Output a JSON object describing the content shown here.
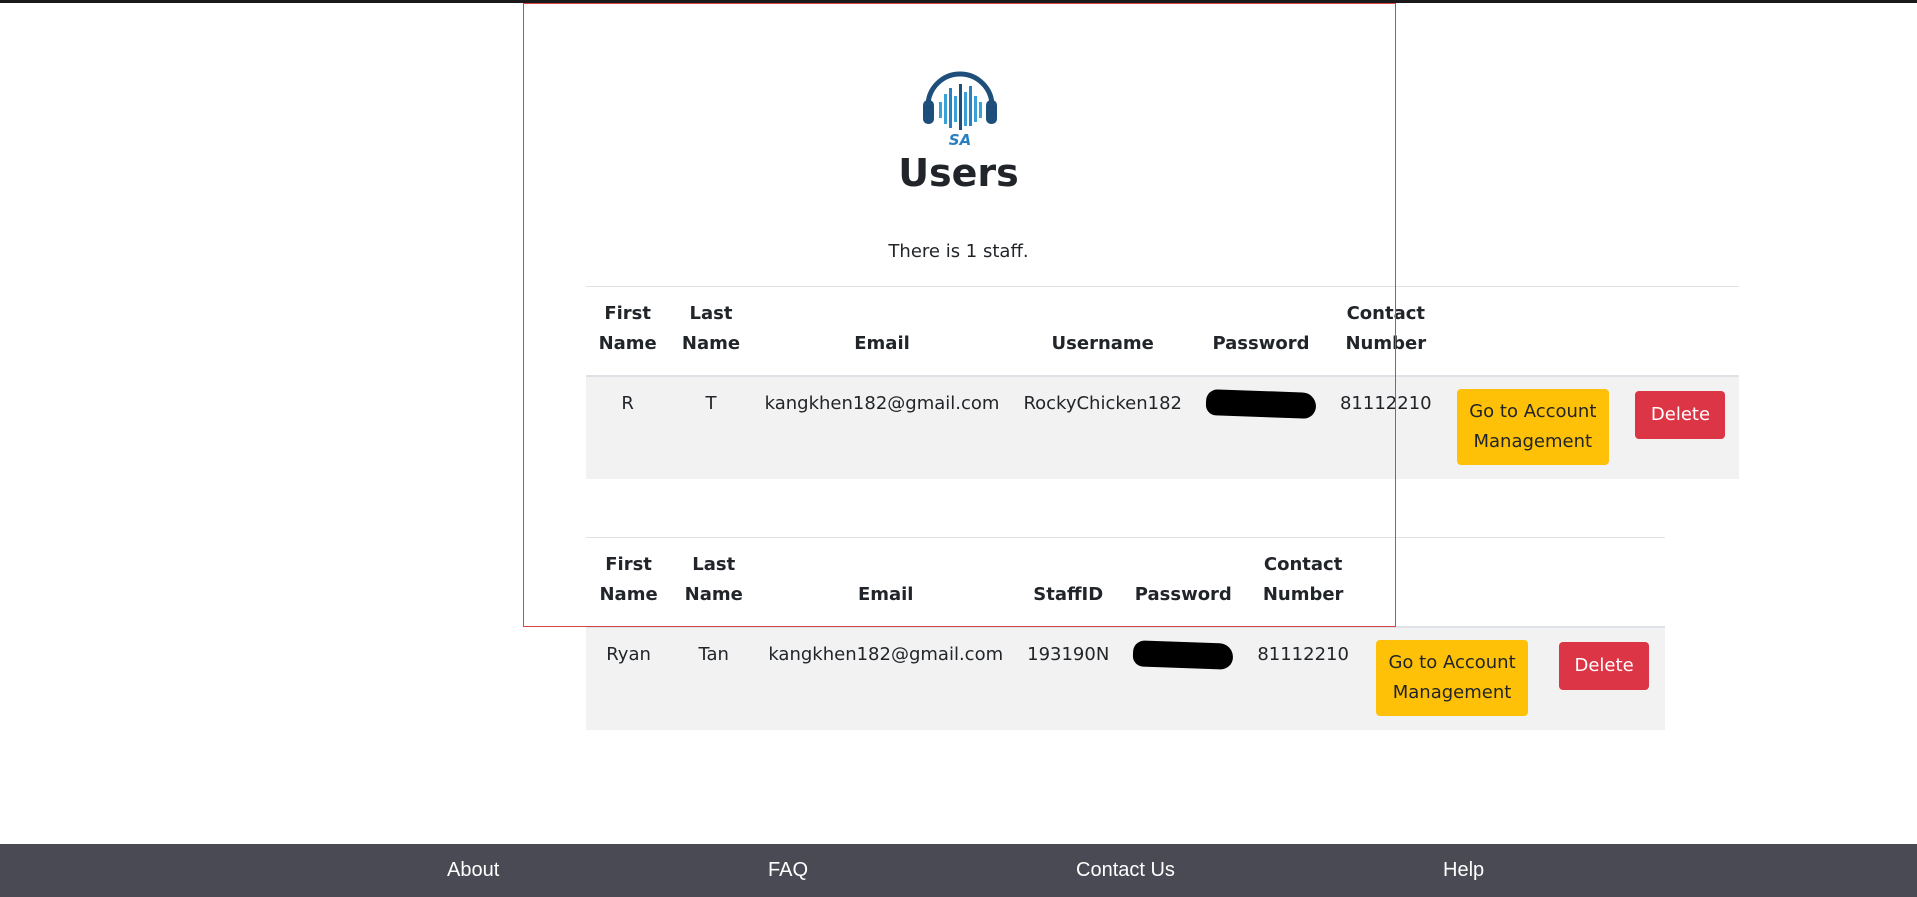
{
  "logo": {
    "text": "SA",
    "icon": "headphones-soundwave-logo"
  },
  "page": {
    "title": "Users",
    "staff_count_text": "There is 1 staff."
  },
  "users_table": {
    "headers": {
      "first_name": "First Name",
      "last_name": "Last Name",
      "email": "Email",
      "username": "Username",
      "password": "Password",
      "contact": "Contact Number"
    },
    "rows": [
      {
        "first_name": "R",
        "last_name": "T",
        "email": "kangkhen182@gmail.com",
        "username": "RockyChicken182",
        "contact": "81112210",
        "manage_label": "Go to Account Management",
        "delete_label": "Delete"
      }
    ]
  },
  "staff_table": {
    "headers": {
      "first_name": "First Name",
      "last_name": "Last Name",
      "email": "Email",
      "staff_id": "StaffID",
      "password": "Password",
      "contact": "Contact Number"
    },
    "rows": [
      {
        "first_name": "Ryan",
        "last_name": "Tan",
        "email": "kangkhen182@gmail.com",
        "staff_id": "193190N",
        "contact": "81112210",
        "manage_label": "Go to Account Management",
        "delete_label": "Delete"
      }
    ]
  },
  "footer": {
    "about": "About",
    "faq": "FAQ",
    "contact": "Contact Us",
    "help": "Help"
  },
  "colors": {
    "warning": "#ffc107",
    "danger": "#dc3545",
    "footer_bg": "#4a4a55",
    "row_bg": "#f2f2f2"
  }
}
